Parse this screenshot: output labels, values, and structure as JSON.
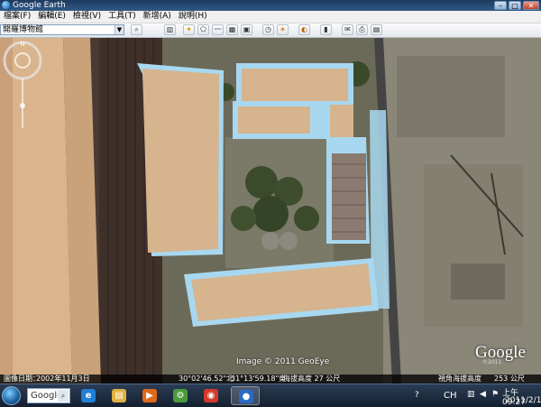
{
  "window": {
    "title": "Google Earth",
    "controls": [
      "–",
      "□",
      "✕"
    ]
  },
  "menu": [
    {
      "label": "檔案(F)"
    },
    {
      "label": "編輯(E)"
    },
    {
      "label": "檢視(V)"
    },
    {
      "label": "工具(T)"
    },
    {
      "label": "新增(A)"
    },
    {
      "label": "說明(H)"
    }
  ],
  "search": {
    "value": "開羅博物館"
  },
  "toolbar_icons": [
    "sidebar-icon",
    "placemark-icon",
    "polygon-icon",
    "path-icon",
    "overlay-icon",
    "tour-icon",
    "historical-imagery-icon",
    "sunlight-icon",
    "planets-icon",
    "ruler-icon",
    "email-icon",
    "print-icon",
    "maps-icon"
  ],
  "map": {
    "image_credit": "Image © 2011 GeoEye",
    "logo": "Google",
    "logo_copy": "©2011"
  },
  "status": {
    "date_label": "圖像日期：",
    "date_value": "2002年11月3日",
    "lat": "30°02'46.52\"北",
    "lon": "31°13'59.18\"東",
    "elev": "海拔高度  27 公尺",
    "eye_alt_label": "視角海拔高度",
    "eye_alt_value": "253 公尺"
  },
  "taskbar": {
    "search_text": "Google",
    "apps": [
      {
        "name": "ie",
        "glyph": "e",
        "color": "#1e7fd6"
      },
      {
        "name": "explorer",
        "glyph": "▤",
        "color": "#e0b040"
      },
      {
        "name": "media",
        "glyph": "▶",
        "color": "#e06a1a"
      },
      {
        "name": "network",
        "glyph": "⚙",
        "color": "#4a9a3a"
      },
      {
        "name": "chrome",
        "glyph": "◉",
        "color": "#d23a2a"
      },
      {
        "name": "google-earth",
        "glyph": "●",
        "color": "#2a6ac4"
      }
    ],
    "language": "CH",
    "time": "上午 09:27",
    "date": "2011/2/12"
  }
}
